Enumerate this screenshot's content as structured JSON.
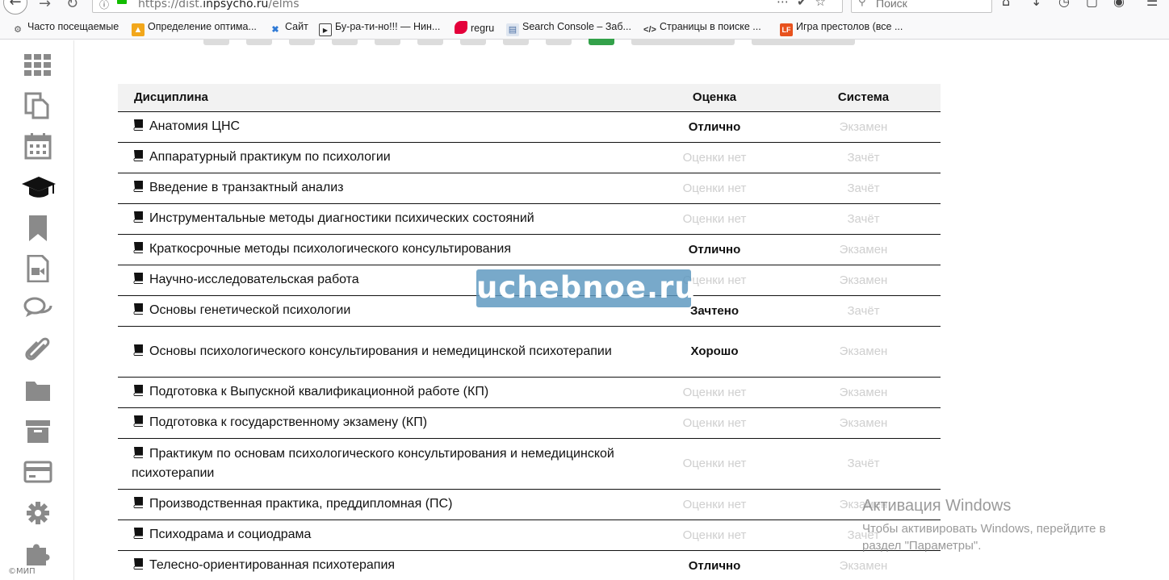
{
  "browser": {
    "url_prefix": "https://dist.",
    "url_host": "inpsycho.ru",
    "url_path": "/elms",
    "search_placeholder": "Поиск",
    "bookmarks": [
      {
        "label": "Часто посещаемые",
        "icon": "gear-icon",
        "color": "#555555"
      },
      {
        "label": "Определение оптима...",
        "icon": "thumb-icon",
        "color": "#f2a71b"
      },
      {
        "label": "Сайт",
        "icon": "x-icon",
        "color": "#2f7ad6"
      },
      {
        "label": "Бу-ра-ти-но!!! — Нин...",
        "icon": "play-icon",
        "color": "#222222"
      },
      {
        "label": "regru",
        "icon": "regru-icon",
        "color": "#e4003a"
      },
      {
        "label": "Search Console – Заб...",
        "icon": "console-icon",
        "color": "#4a6fa5"
      },
      {
        "label": "Страницы в поиске ...",
        "icon": "code-icon",
        "color": "#333333"
      },
      {
        "label": "Игра престолов (все ...",
        "icon": "lf-icon",
        "color": "#e8521e"
      }
    ]
  },
  "sidebar": {
    "items": [
      {
        "icon": "apps-grid-icon"
      },
      {
        "icon": "documents-icon"
      },
      {
        "icon": "calendar-icon"
      },
      {
        "icon": "graduation-cap-icon"
      },
      {
        "icon": "bookmark-icon"
      },
      {
        "icon": "video-file-icon"
      },
      {
        "icon": "chat-icon"
      },
      {
        "icon": "paperclip-icon"
      },
      {
        "icon": "folder-icon"
      },
      {
        "icon": "archive-icon"
      },
      {
        "icon": "payment-card-icon"
      },
      {
        "icon": "settings-icon"
      },
      {
        "icon": "puzzle-icon"
      }
    ],
    "copyright": "©МИП"
  },
  "table": {
    "headers": {
      "discipline": "Дисциплина",
      "grade": "Оценка",
      "system": "Система"
    },
    "rows": [
      {
        "name": "Анатомия ЦНС",
        "grade": "Отлично",
        "graded": true,
        "system": "Экзамен"
      },
      {
        "name": "Аппаратурный практикум по психологии",
        "grade": "Оценки нет",
        "graded": false,
        "system": "Зачёт"
      },
      {
        "name": "Введение в транзактный анализ",
        "grade": "Оценки нет",
        "graded": false,
        "system": "Зачёт"
      },
      {
        "name": "Инструментальные методы диагностики психических состояний",
        "grade": "Оценки нет",
        "graded": false,
        "system": "Зачёт"
      },
      {
        "name": "Краткосрочные методы психологического консультирования",
        "grade": "Отлично",
        "graded": true,
        "system": "Экзамен"
      },
      {
        "name": "Научно-исследовательская работа",
        "grade": "Оценки нет",
        "graded": false,
        "system": "Экзамен"
      },
      {
        "name": "Основы генетической психологии",
        "grade": "Зачтено",
        "graded": true,
        "system": "Зачёт"
      },
      {
        "name": "Основы психологического консультирования и немедицинской психотерапии",
        "grade": "Хорошо",
        "graded": true,
        "system": "Экзамен"
      },
      {
        "name": "Подготовка к Выпускной квалификационной работе (КП)",
        "grade": "Оценки нет",
        "graded": false,
        "system": "Экзамен"
      },
      {
        "name": "Подготовка к государственному экзамену (КП)",
        "grade": "Оценки нет",
        "graded": false,
        "system": "Экзамен"
      },
      {
        "name": "Практикум по основам психологического консультирования и немедицинской психотерапии",
        "grade": "Оценки нет",
        "graded": false,
        "system": "Зачёт"
      },
      {
        "name": "Производственная практика, преддипломная (ПС)",
        "grade": "Оценки нет",
        "graded": false,
        "system": "Экзамен"
      },
      {
        "name": "Психодрама и социодрама",
        "grade": "Оценки нет",
        "graded": false,
        "system": "Зачёт"
      },
      {
        "name": "Телесно-ориентированная психотерапия",
        "grade": "Отлично",
        "graded": true,
        "system": "Экзамен"
      }
    ]
  },
  "watermark": "uchebnoe.ru",
  "windows_activation": {
    "title": "Активация Windows",
    "text": "Чтобы активировать Windows, перейдите в раздел \"Параметры\"."
  }
}
